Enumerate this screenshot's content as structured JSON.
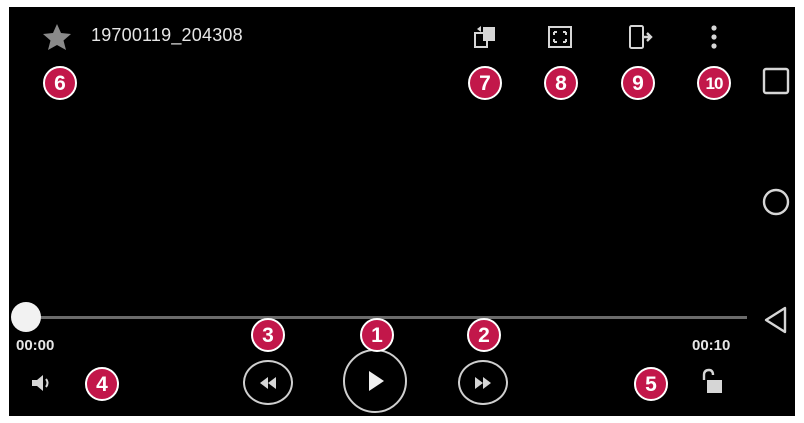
{
  "header": {
    "title": "19700119_204308"
  },
  "playback": {
    "current_time": "00:00",
    "total_time": "00:10",
    "progress": 0.0
  },
  "icons": {
    "favorite": "star-icon",
    "capture": "capture-icon",
    "screen_ratio": "screen-ratio-icon",
    "share_screen": "screen-share-icon",
    "more": "more-options-icon",
    "volume": "volume-icon",
    "rewind": "rewind-icon",
    "play": "play-icon",
    "fast_forward": "fast-forward-icon",
    "lock": "unlock-icon",
    "nav_recents": "recents-icon",
    "nav_home": "home-icon",
    "nav_back": "back-icon"
  },
  "callouts": [
    "1",
    "2",
    "3",
    "4",
    "5",
    "6",
    "7",
    "8",
    "9",
    "10"
  ],
  "colors": {
    "screen_background": "#000000",
    "callout_fill": "#c2174a",
    "icon": "#d6d6d6",
    "seekbar_track": "#6b6b6b"
  }
}
